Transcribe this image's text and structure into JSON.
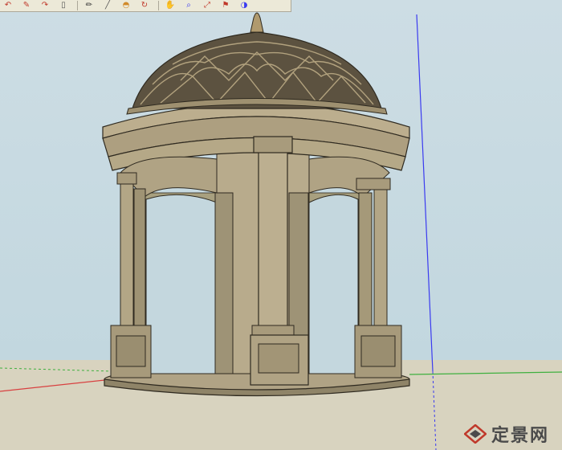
{
  "toolbar": {
    "buttons": [
      {
        "name": "undo-icon",
        "glyph": "↶"
      },
      {
        "name": "erase-icon",
        "glyph": "✎"
      },
      {
        "name": "redo-icon",
        "glyph": "↷"
      },
      {
        "name": "page-icon",
        "glyph": "▯"
      },
      {
        "name": "pencil-icon",
        "glyph": "✏"
      },
      {
        "name": "line-icon",
        "glyph": "╱"
      },
      {
        "name": "paint-bucket-icon",
        "glyph": "◓"
      },
      {
        "name": "orbit-icon",
        "glyph": "↻"
      },
      {
        "name": "hand-icon",
        "glyph": "✋"
      },
      {
        "name": "zoom-icon",
        "glyph": "⌕"
      },
      {
        "name": "zoom-extents-icon",
        "glyph": "⤢"
      },
      {
        "name": "walk-icon",
        "glyph": "⚑"
      },
      {
        "name": "styles-icon",
        "glyph": "◑"
      }
    ]
  },
  "colors": {
    "sky": "#c9dbe3",
    "ground": "#d8d3bf",
    "stone": "#b7a989",
    "stone_dark": "#8a7e63",
    "edge": "#2f2a20",
    "axis_blue": "#3a3af0",
    "axis_red": "#d84040",
    "axis_green": "#3fb03f"
  },
  "watermark": {
    "text": "定景网"
  }
}
